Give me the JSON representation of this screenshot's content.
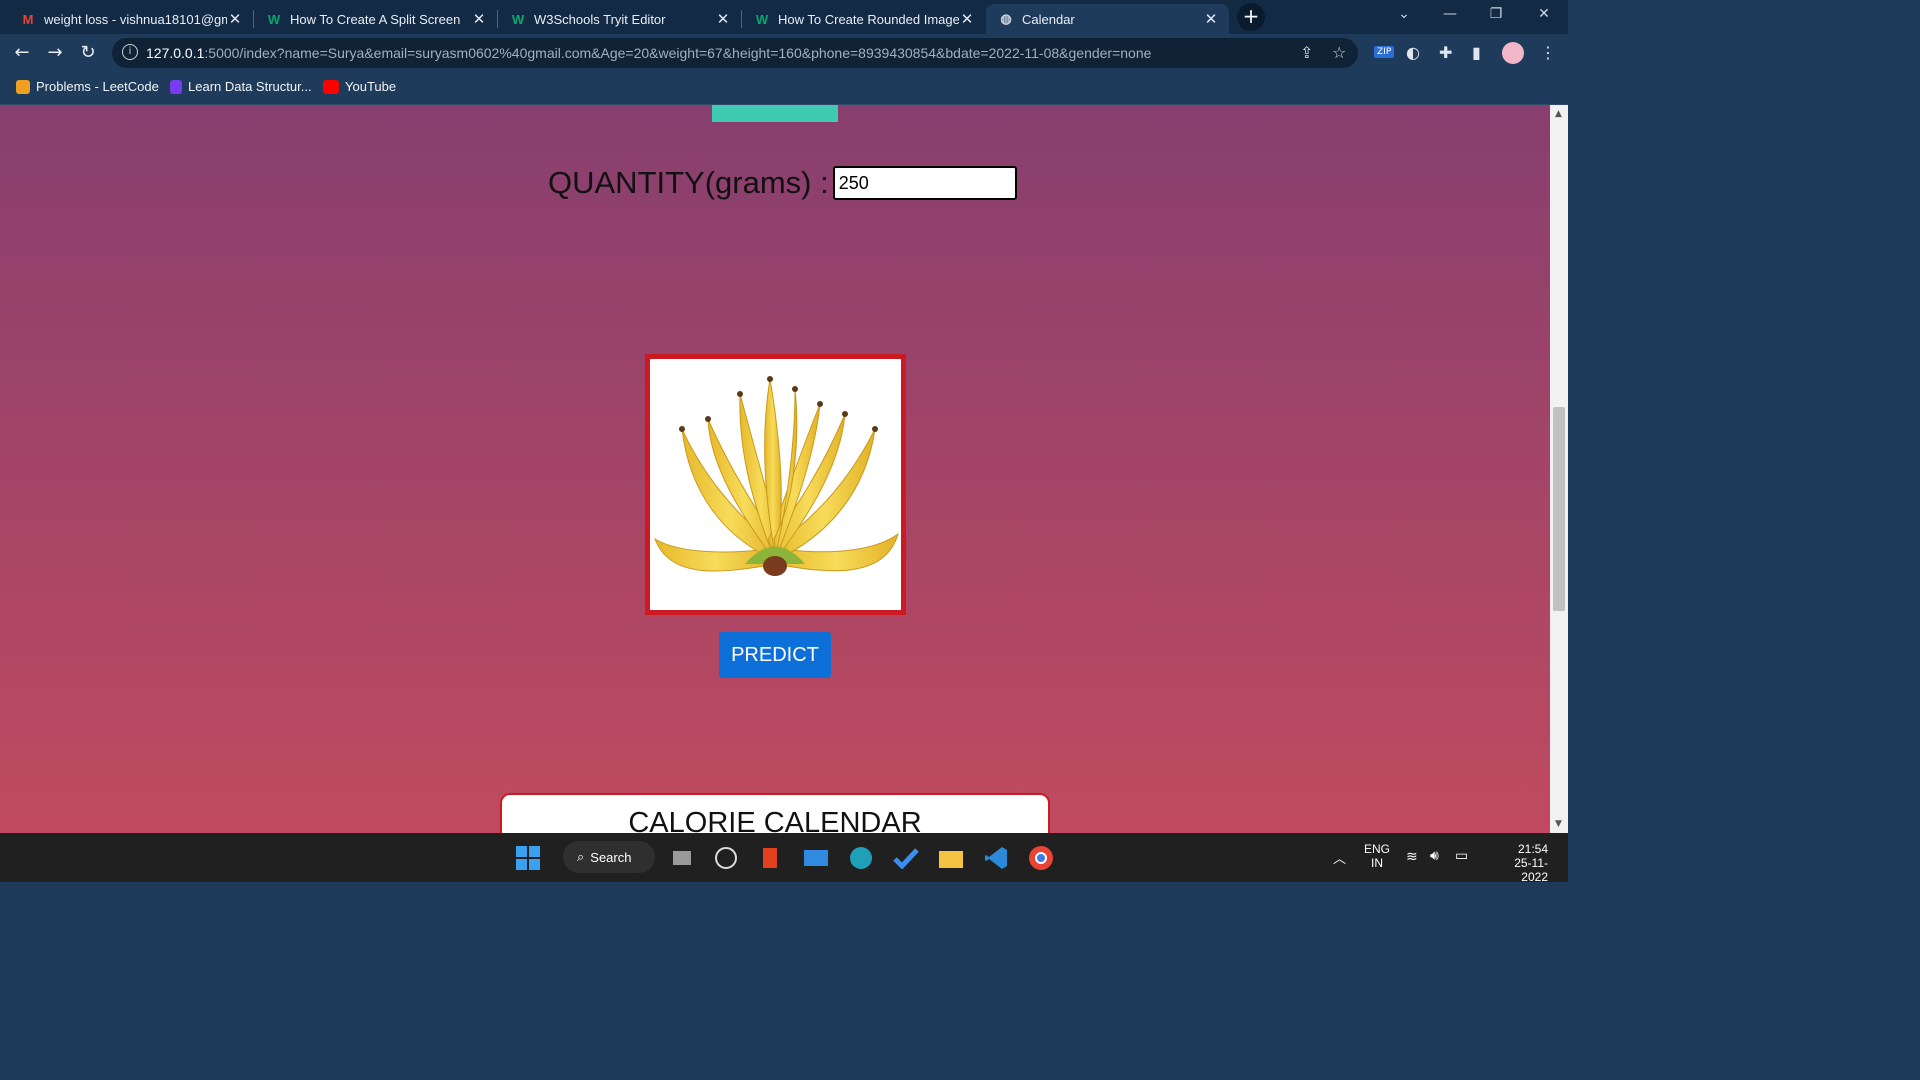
{
  "browser": {
    "tabs": [
      {
        "title": "weight loss - vishnua18101@gm",
        "favicon": "gmail-icon",
        "favicon_color": "#ea4335",
        "active": false
      },
      {
        "title": "How To Create A Split Screen",
        "favicon": "w3schools-icon",
        "favicon_color": "#04aa6d",
        "active": false
      },
      {
        "title": "W3Schools Tryit Editor",
        "favicon": "w3schools-icon",
        "favicon_color": "#04aa6d",
        "active": false
      },
      {
        "title": "How To Create Rounded Images",
        "favicon": "w3schools-icon",
        "favicon_color": "#04aa6d",
        "active": false
      },
      {
        "title": "Calendar",
        "favicon": "globe-icon",
        "favicon_color": "#c9d4df",
        "active": true
      }
    ],
    "url_host": "127.0.0.1",
    "url_rest": ":5000/index?name=Surya&email=suryasm0602%40gmail.com&Age=20&weight=67&height=160&phone=8939430854&bdate=2022-11-08&gender=none",
    "bookmarks": [
      {
        "label": "Problems - LeetCode",
        "icon": "leetcode-icon",
        "color": "#f0a020"
      },
      {
        "label": "Learn Data Structur...",
        "icon": "pointer-icon",
        "color": "#7a3cf2"
      },
      {
        "label": "YouTube",
        "icon": "youtube-icon",
        "color": "#ff0000"
      }
    ]
  },
  "page": {
    "quantity_label": "QUANTITY(grams) :",
    "quantity_value": "250",
    "predict_label": "PREDICT",
    "calendar_title": "CALORIE CALENDAR",
    "accent_teal": "#3fcbb2",
    "accent_red": "#cc1a22",
    "button_blue": "#0d6fd8"
  },
  "taskbar": {
    "search_label": "Search",
    "language": "ENG",
    "region": "IN",
    "time": "21:54",
    "date": "25-11-2022"
  }
}
